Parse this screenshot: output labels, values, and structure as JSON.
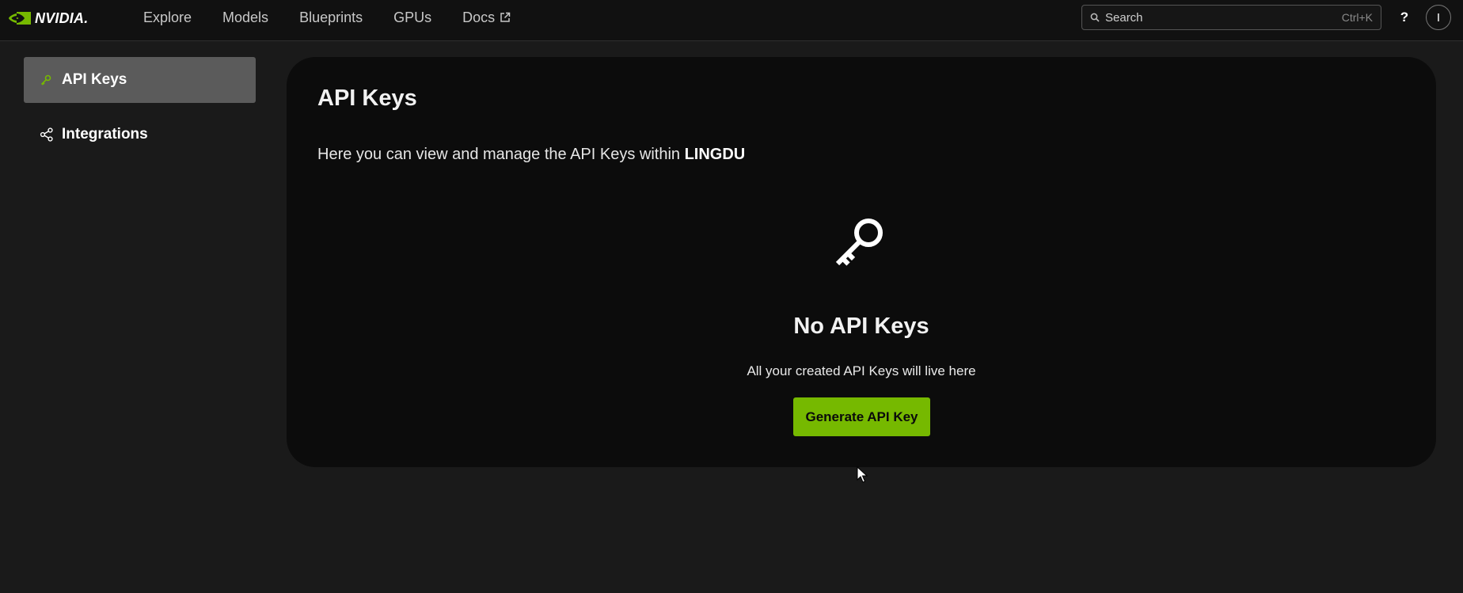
{
  "brand": {
    "name": "NVIDIA.",
    "accent_color": "#76b900"
  },
  "nav": {
    "items": [
      {
        "label": "Explore"
      },
      {
        "label": "Models"
      },
      {
        "label": "Blueprints"
      },
      {
        "label": "GPUs"
      },
      {
        "label": "Docs",
        "icon": "external-link-icon"
      }
    ]
  },
  "search": {
    "placeholder": "Search",
    "shortcut": "Ctrl+K"
  },
  "header": {
    "help_label": "?",
    "avatar_initial": "I"
  },
  "sidebar": {
    "items": [
      {
        "label": "API Keys",
        "icon": "key-icon",
        "active": true
      },
      {
        "label": "Integrations",
        "icon": "share-nodes-icon",
        "active": false
      }
    ]
  },
  "main": {
    "title": "API Keys",
    "description_prefix": "Here you can view and manage the API Keys within ",
    "org_name": "LINGDU",
    "empty_state": {
      "icon": "key-icon",
      "title": "No API Keys",
      "subtitle": "All your created API Keys will live here",
      "button_label": "Generate API Key"
    }
  }
}
